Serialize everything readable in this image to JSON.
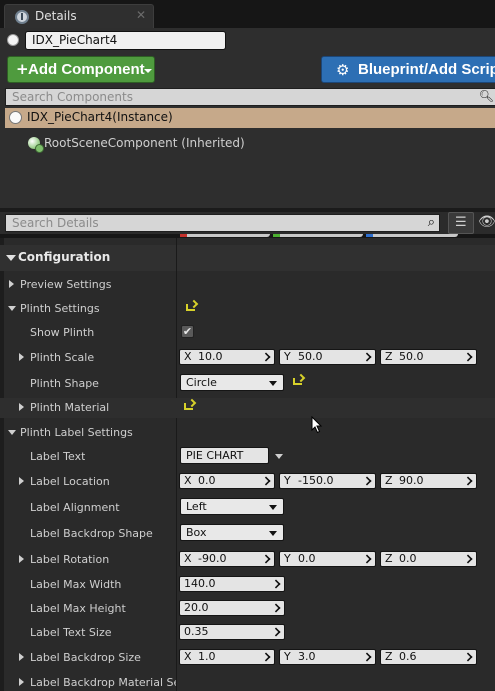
{
  "tab": {
    "title": "Details",
    "close": "✕"
  },
  "actor": {
    "name": "IDX_PieChart4"
  },
  "toolbar": {
    "add_component_label": "Add Component",
    "blueprint_label": "Blueprint/Add Script"
  },
  "components": {
    "search_placeholder": "Search Components",
    "instance_label": "IDX_PieChart4(Instance)",
    "root_label": "RootSceneComponent (Inherited)"
  },
  "details": {
    "search_placeholder": "Search Details"
  },
  "configuration": {
    "header": "Configuration",
    "preview_settings": "Preview Settings",
    "plinth_settings": {
      "label": "Plinth Settings",
      "show_plinth": {
        "label": "Show Plinth",
        "checked": true
      },
      "plinth_scale": {
        "label": "Plinth Scale",
        "x": "10.0",
        "y": "50.0",
        "z": "50.0"
      },
      "plinth_shape": {
        "label": "Plinth Shape",
        "value": "Circle"
      },
      "plinth_material": {
        "label": "Plinth Material"
      }
    },
    "plinth_label_settings": {
      "label": "Plinth Label Settings",
      "label_text": {
        "label": "Label Text",
        "value": "PIE CHART"
      },
      "label_location": {
        "label": "Label Location",
        "x": "0.0",
        "y": "-150.0",
        "z": "90.0"
      },
      "label_alignment": {
        "label": "Label Alignment",
        "value": "Left"
      },
      "label_backdrop_shape": {
        "label": "Label Backdrop Shape",
        "value": "Box"
      },
      "label_rotation": {
        "label": "Label Rotation",
        "x": "-90.0",
        "y": "0.0",
        "z": "0.0"
      },
      "label_max_width": {
        "label": "Label Max Width",
        "value": "140.0"
      },
      "label_max_height": {
        "label": "Label Max Height",
        "value": "20.0"
      },
      "label_text_size": {
        "label": "Label Text Size",
        "value": "0.35"
      },
      "label_backdrop_size": {
        "label": "Label Backdrop Size",
        "x": "1.0",
        "y": "3.0",
        "z": "0.6"
      },
      "label_backdrop_material": {
        "label": "Label Backdrop Material Setti"
      }
    },
    "axis": {
      "x": "X",
      "y": "Y",
      "z": "Z"
    }
  },
  "colors": {
    "add_component": "#4f9b3e",
    "blueprint": "#2d6fb4",
    "instance_row": "#c6a98a",
    "reset_arrow": "#d7d12a"
  }
}
